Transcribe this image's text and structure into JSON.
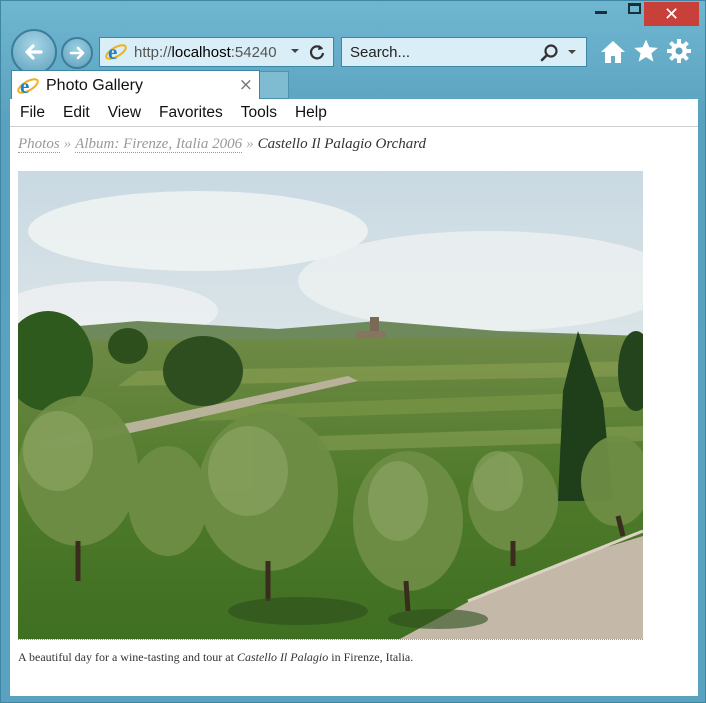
{
  "window": {
    "close_glyph": "✕"
  },
  "address_bar": {
    "url_scheme": "http://",
    "url_host": "localhost",
    "url_port": ":54240"
  },
  "search": {
    "placeholder": "Search..."
  },
  "tab": {
    "title": "Photo Gallery",
    "close_glyph": "×"
  },
  "menu": {
    "items": [
      "File",
      "Edit",
      "View",
      "Favorites",
      "Tools",
      "Help"
    ]
  },
  "breadcrumb": {
    "items": [
      "Photos",
      "Album: Firenze, Italia 2006"
    ],
    "separator": "»",
    "current": "Castello Il Palagio Orchard"
  },
  "photo": {
    "subject": "olive orchard landscape"
  },
  "caption": {
    "before": "A beautiful day for a wine-tasting and tour at ",
    "emphasis": "Castello Il Palagio",
    "after": " in Firenze, Italia."
  },
  "colors": {
    "chrome": "#5aa3c0",
    "close_button": "#c7403a",
    "ie_blue": "#1e7fd1",
    "ie_gold": "#f0b21c"
  },
  "icons": {
    "back": "back-arrow-icon",
    "forward": "forward-arrow-icon",
    "home": "home-icon",
    "favorites": "star-icon",
    "tools": "gear-icon",
    "search": "search-icon",
    "refresh": "refresh-icon",
    "ie": "ie-logo-icon"
  }
}
